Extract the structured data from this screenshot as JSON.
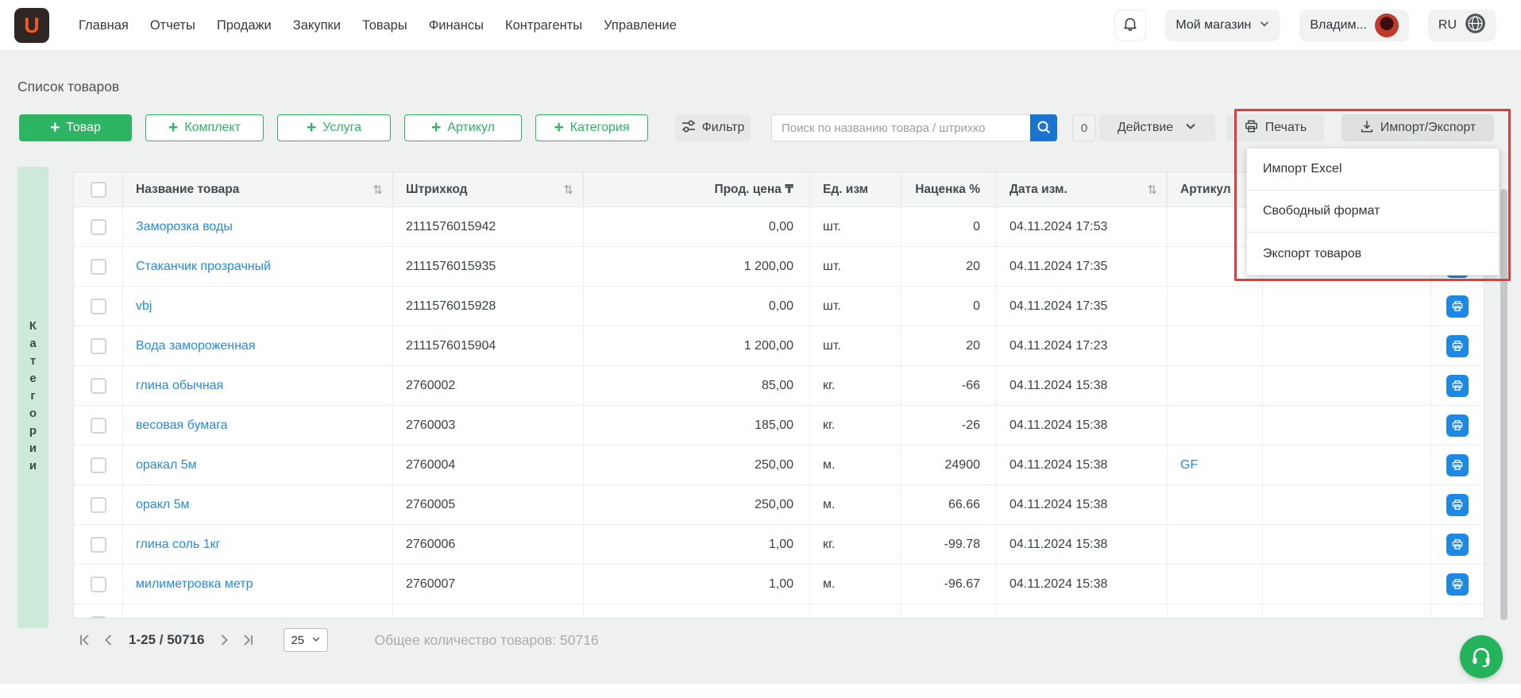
{
  "nav": {
    "logo": "U",
    "items": [
      "Главная",
      "Отчеты",
      "Продажи",
      "Закупки",
      "Товары",
      "Финансы",
      "Контрагенты",
      "Управление"
    ],
    "store": "Мой магазин",
    "user": "Владим...",
    "lang": "RU"
  },
  "page": {
    "title": "Список товаров"
  },
  "toolbar": {
    "add_product": "Товар",
    "add_kit": "Комплект",
    "add_service": "Услуга",
    "add_sku": "Артикул",
    "add_category": "Категория",
    "filter": "Фильтр",
    "search_placeholder": "Поиск по названию товара / штрихко",
    "selection_count": "0",
    "action": "Действие",
    "print": "Печать",
    "import_export": "Импорт/Экспорт"
  },
  "import_export_menu": [
    "Импорт Excel",
    "Свободный формат",
    "Экспорт товаров"
  ],
  "categories_strip": "Категории",
  "icons": {
    "sort": "⇅"
  },
  "table": {
    "columns": [
      "Название товара",
      "Штрихкод",
      "Прод. цена ₸",
      "Ед. изм",
      "Наценка %",
      "Дата изм.",
      "Артикул"
    ],
    "rows": [
      {
        "name": "Заморозка воды",
        "barcode": "2111576015942",
        "price": "0,00",
        "unit": "шт.",
        "markup": "0",
        "modified": "04.11.2024 17:53",
        "sku": ""
      },
      {
        "name": "Стаканчик прозрачный",
        "barcode": "2111576015935",
        "price": "1 200,00",
        "unit": "шт.",
        "markup": "20",
        "modified": "04.11.2024 17:35",
        "sku": ""
      },
      {
        "name": "vbj",
        "barcode": "2111576015928",
        "price": "0,00",
        "unit": "шт.",
        "markup": "0",
        "modified": "04.11.2024 17:35",
        "sku": ""
      },
      {
        "name": "Вода замороженная",
        "barcode": "2111576015904",
        "price": "1 200,00",
        "unit": "шт.",
        "markup": "20",
        "modified": "04.11.2024 17:23",
        "sku": ""
      },
      {
        "name": "глина обычная",
        "barcode": "2760002",
        "price": "85,00",
        "unit": "кг.",
        "markup": "-66",
        "modified": "04.11.2024 15:38",
        "sku": ""
      },
      {
        "name": "весовая бумага",
        "barcode": "2760003",
        "price": "185,00",
        "unit": "кг.",
        "markup": "-26",
        "modified": "04.11.2024 15:38",
        "sku": ""
      },
      {
        "name": "оракал 5м",
        "barcode": "2760004",
        "price": "250,00",
        "unit": "м.",
        "markup": "24900",
        "modified": "04.11.2024 15:38",
        "sku": "GF"
      },
      {
        "name": "оракл 5м",
        "barcode": "2760005",
        "price": "250,00",
        "unit": "м.",
        "markup": "66.66",
        "modified": "04.11.2024 15:38",
        "sku": ""
      },
      {
        "name": "глина соль 1кг",
        "barcode": "2760006",
        "price": "1,00",
        "unit": "кг.",
        "markup": "-99.78",
        "modified": "04.11.2024 15:38",
        "sku": ""
      },
      {
        "name": "милиметровка метр",
        "barcode": "2760007",
        "price": "1,00",
        "unit": "м.",
        "markup": "-96.67",
        "modified": "04.11.2024 15:38",
        "sku": ""
      }
    ]
  },
  "pagination": {
    "range": "1-25 / 50716",
    "page_size": "25",
    "total": "Общее количество товаров: 50716"
  },
  "colors": {
    "accent_green": "#2db563",
    "link_blue": "#1f8ceb",
    "highlight_red": "#e23b3b",
    "search_blue": "#1a73cf"
  }
}
